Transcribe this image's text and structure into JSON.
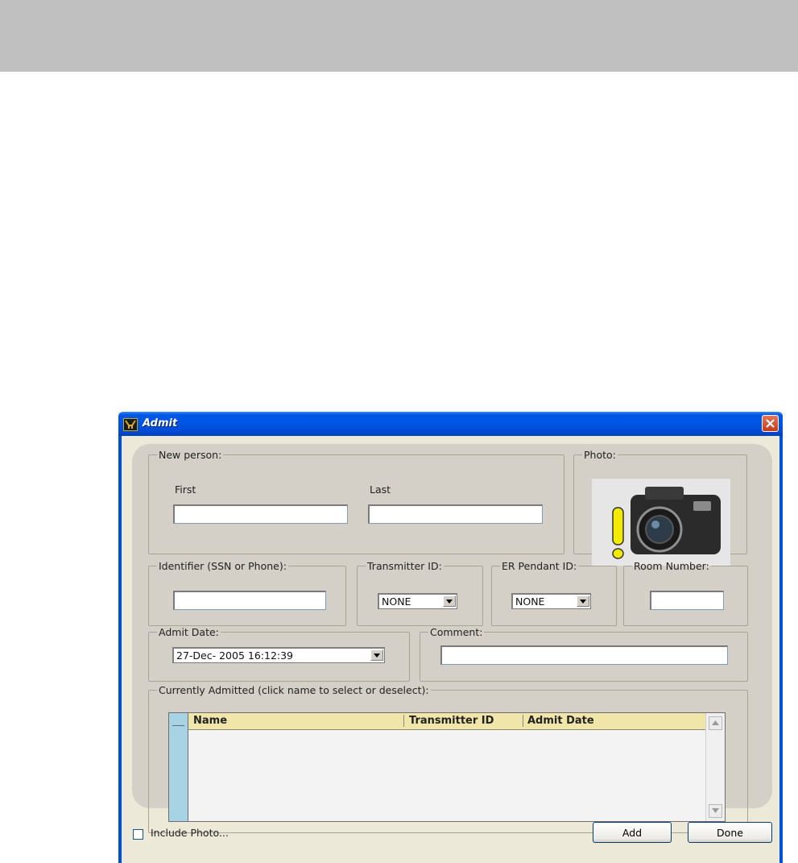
{
  "window": {
    "title": "Admit"
  },
  "new_person": {
    "legend": "New person:",
    "first_label": "First",
    "last_label": "Last",
    "first_value": "",
    "last_value": ""
  },
  "photo": {
    "legend": "Photo:"
  },
  "identifier": {
    "legend": "Identifier (SSN or Phone):",
    "value": ""
  },
  "transmitter": {
    "legend": "Transmitter ID:",
    "selected": "NONE"
  },
  "er_pendant": {
    "legend": "ER Pendant ID:",
    "selected": "NONE"
  },
  "room": {
    "legend": "Room Number:",
    "value": ""
  },
  "admit_date": {
    "legend": "Admit Date:",
    "value": "27-Dec- 2005  16:12:39"
  },
  "comment": {
    "legend": "Comment:",
    "value": ""
  },
  "admitted": {
    "legend": "Currently Admitted (click name to select or deselect):",
    "columns": [
      "Name",
      "Transmitter ID",
      "Admit Date"
    ],
    "rows": []
  },
  "footer": {
    "include_photo_label": "Include Photo...",
    "include_photo_checked": false,
    "add_label": "Add",
    "done_label": "Done"
  },
  "colors": {
    "title_blue": "#0055e5",
    "header_yellow": "#f1e6a9",
    "row_header_blue": "#a7d3e4",
    "panel_gray": "#d4d0c8"
  }
}
